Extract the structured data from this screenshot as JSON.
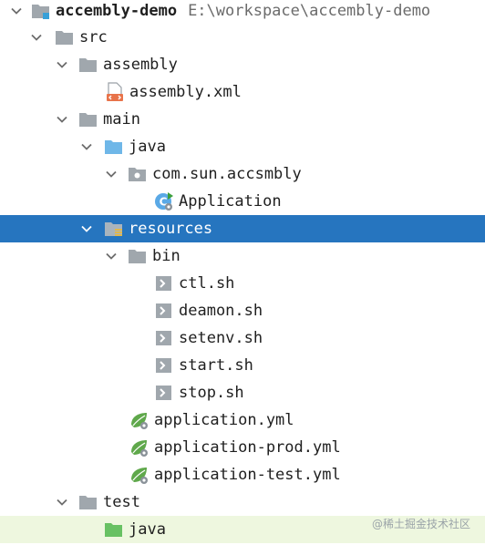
{
  "tree": {
    "root": {
      "name": "accembly-demo",
      "path": "E:\\workspace\\accembly-demo"
    },
    "items": [
      {
        "label": "src",
        "icon": "folder-icon"
      },
      {
        "label": "assembly",
        "icon": "folder-icon"
      },
      {
        "label": "assembly.xml",
        "icon": "xml-file-icon"
      },
      {
        "label": "main",
        "icon": "folder-icon"
      },
      {
        "label": "java",
        "icon": "source-folder-icon"
      },
      {
        "label": "com.sun.accsmbly",
        "icon": "package-icon"
      },
      {
        "label": "Application",
        "icon": "spring-class-icon"
      },
      {
        "label": "resources",
        "icon": "resources-folder-icon"
      },
      {
        "label": "bin",
        "icon": "folder-icon"
      },
      {
        "label": "ctl.sh",
        "icon": "shell-script-icon"
      },
      {
        "label": "deamon.sh",
        "icon": "shell-script-icon"
      },
      {
        "label": "setenv.sh",
        "icon": "shell-script-icon"
      },
      {
        "label": "start.sh",
        "icon": "shell-script-icon"
      },
      {
        "label": "stop.sh",
        "icon": "shell-script-icon"
      },
      {
        "label": "application.yml",
        "icon": "spring-config-icon"
      },
      {
        "label": "application-prod.yml",
        "icon": "spring-config-icon"
      },
      {
        "label": "application-test.yml",
        "icon": "spring-config-icon"
      },
      {
        "label": "test",
        "icon": "folder-icon"
      },
      {
        "label": "java",
        "icon": "test-source-folder-icon"
      }
    ],
    "selected": "resources"
  },
  "colors": {
    "selection": "#2675bf",
    "folder": "#a0a7ad",
    "source_folder": "#6fb7e8",
    "test_folder": "#68c163",
    "spring_green": "#5fa84b",
    "row_highlight": "#eef7df"
  },
  "watermark": "@稀土掘金技术社区"
}
